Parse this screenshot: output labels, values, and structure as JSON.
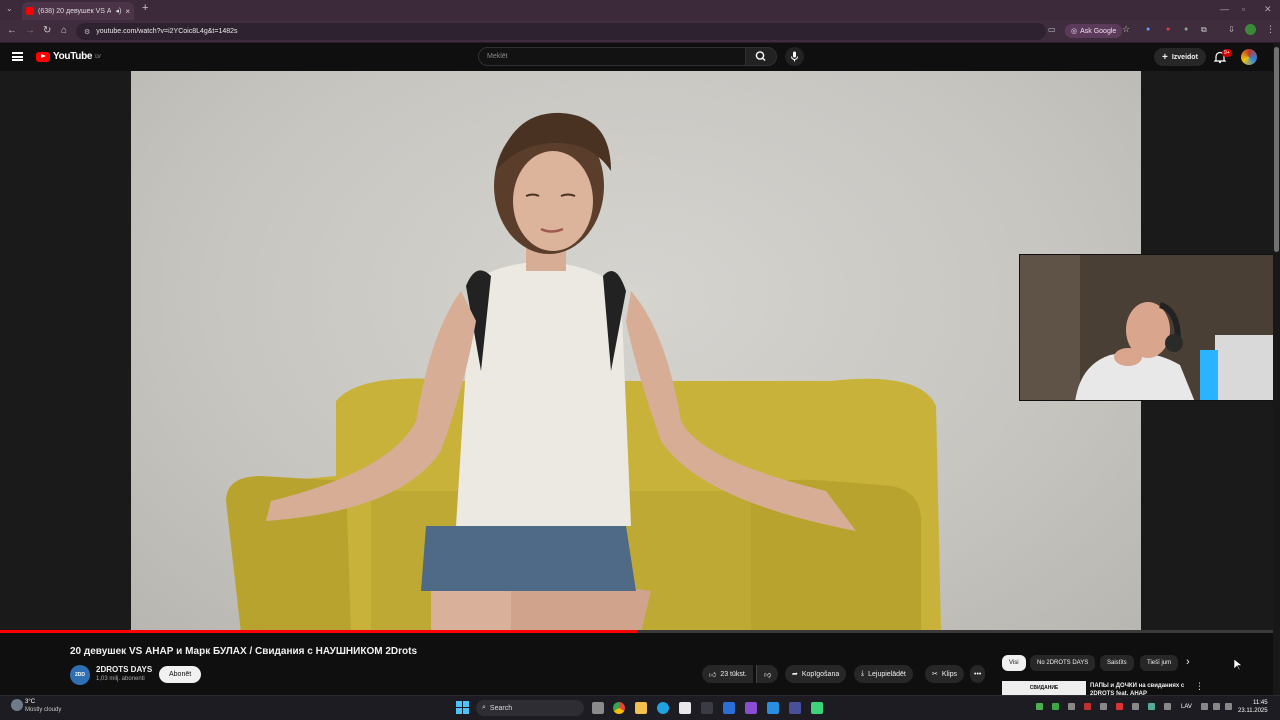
{
  "browser": {
    "tab_title": "(638) 20 девушек VS АНАР",
    "url": "youtube.com/watch?v=i2YCoic8L4g&t=1482s",
    "ask_google": "Ask Google"
  },
  "masthead": {
    "logo_text": "YouTube",
    "logo_country": "LV",
    "search_placeholder": "Meklēt",
    "create_label": "Izveidot",
    "notif_count": "9+"
  },
  "player": {
    "progress_fraction": 0.5
  },
  "video_info": {
    "title": "20 девушек VS АНАР и Марк БУЛАХ / Свидания с НАУШНИКОМ 2Drots",
    "channel_avatar_text": "2DD",
    "channel_name": "2DROTS DAYS",
    "subscribers": "1,03 milj. abonenti",
    "subscribe_label": "Abonēt",
    "likes_label": "23 tūkst.",
    "share_label": "Kopīgošana",
    "download_label": "Lejupielādēt",
    "clip_label": "Klips",
    "more_label": "•••"
  },
  "chips": [
    {
      "label": "Visi",
      "active": true
    },
    {
      "label": "No 2DROTS DAYS",
      "active": false
    },
    {
      "label": "Saistīts",
      "active": false
    },
    {
      "label": "Tiešī jum",
      "active": false
    }
  ],
  "recommendation": {
    "thumb_text": "СВИДАНИЕ",
    "title": "ПАПЫ и ДОЧКИ на свиданиях с 2DROTS feat. АНАР"
  },
  "taskbar": {
    "temperature": "3°C",
    "weather": "Mostly cloudy",
    "search_label": "Search",
    "language": "LAV",
    "time": "11:45",
    "date": "23.11.2025"
  },
  "colors": {
    "accent": "#ff0000",
    "tabstrip": "#3c2a3a",
    "page_bg": "#0f0f0f"
  }
}
